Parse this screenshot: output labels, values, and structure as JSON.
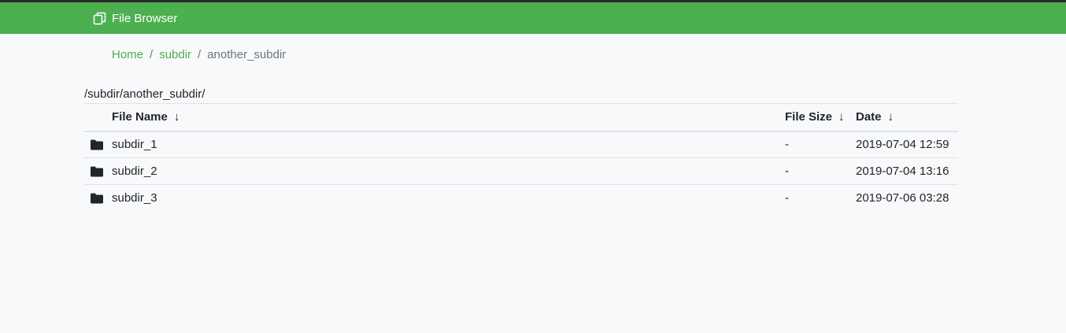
{
  "navbar": {
    "brand": "File Browser",
    "brand_icon": "copy-icon",
    "background": "#4caf50"
  },
  "breadcrumb": {
    "items": [
      "Home",
      "subdir"
    ],
    "separator": "/",
    "current": "another_subdir"
  },
  "current_path": "/subdir/another_subdir/",
  "table": {
    "headers": {
      "name": "File Name",
      "size": "File Size",
      "date": "Date",
      "sort_arrow": "↓"
    },
    "rows": [
      {
        "icon": "folder-icon",
        "name": "subdir_1",
        "size": "-",
        "date": "2019-07-04 12:59"
      },
      {
        "icon": "folder-icon",
        "name": "subdir_2",
        "size": "-",
        "date": "2019-07-04 13:16"
      },
      {
        "icon": "folder-icon",
        "name": "subdir_3",
        "size": "-",
        "date": "2019-07-06 03:28"
      }
    ]
  }
}
